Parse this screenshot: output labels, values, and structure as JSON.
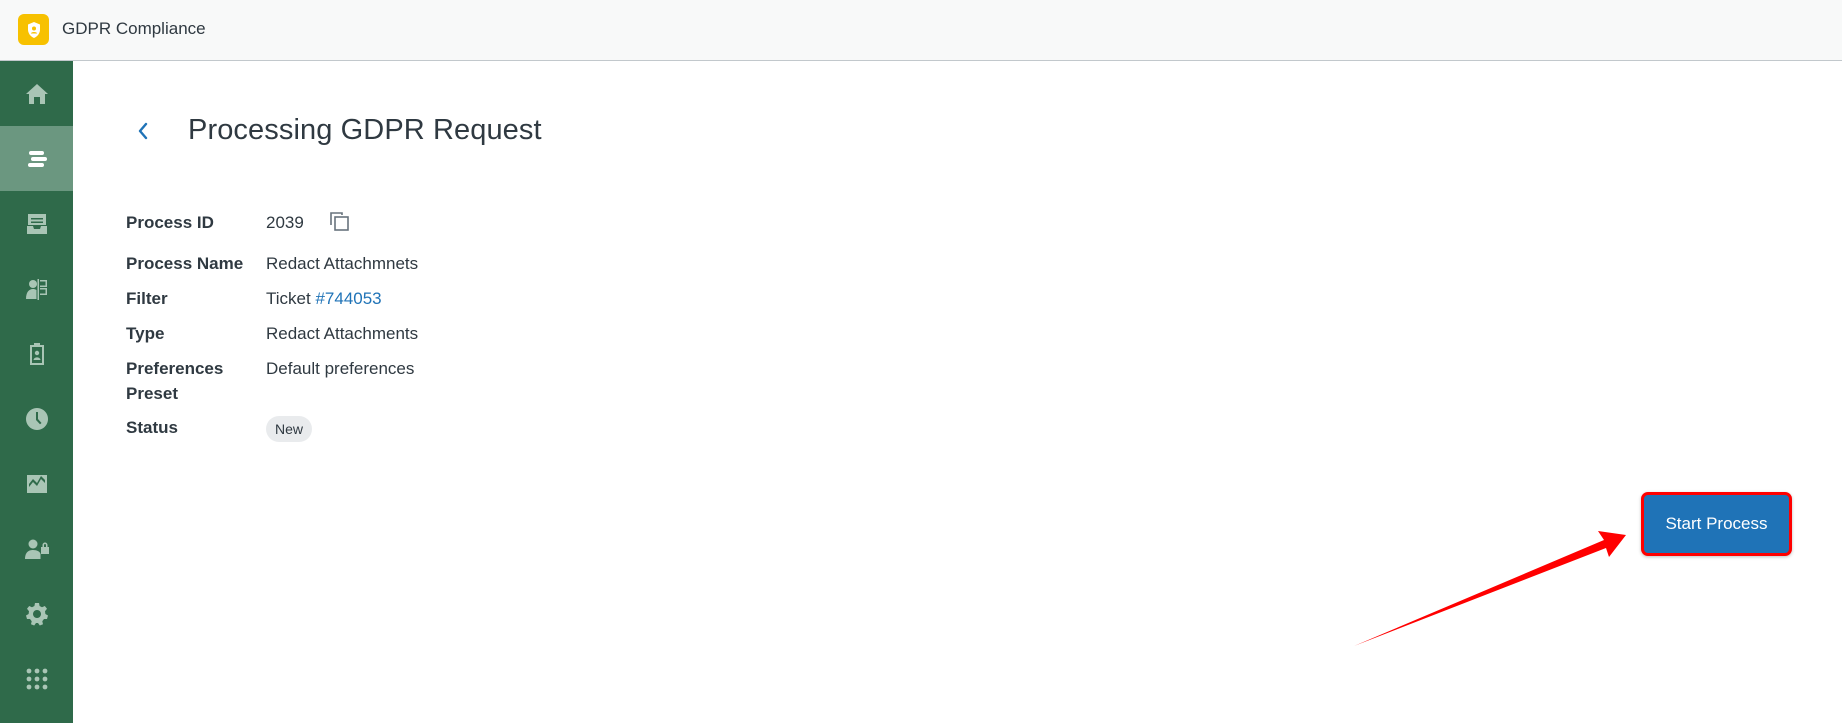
{
  "app": {
    "title": "GDPR Compliance",
    "logo_icon": "shield-user-icon",
    "logo_color": "#f7c100"
  },
  "sidebar": {
    "background": "#2f6a4a",
    "active_index": 1,
    "items": [
      {
        "name": "home",
        "icon": "home-icon"
      },
      {
        "name": "requests",
        "icon": "list-icon"
      },
      {
        "name": "archive",
        "icon": "archive-icon"
      },
      {
        "name": "contacts",
        "icon": "person-book-icon"
      },
      {
        "name": "reports",
        "icon": "clipboard-user-icon"
      },
      {
        "name": "history",
        "icon": "clock-icon"
      },
      {
        "name": "analytics",
        "icon": "chart-icon"
      },
      {
        "name": "access",
        "icon": "user-lock-icon"
      },
      {
        "name": "settings",
        "icon": "gear-icon"
      },
      {
        "name": "apps",
        "icon": "grid-icon"
      }
    ]
  },
  "page": {
    "title": "Processing GDPR Request",
    "back_icon": "chevron-left-icon"
  },
  "details": {
    "process_id": {
      "label": "Process ID",
      "value": "2039"
    },
    "process_name": {
      "label": "Process Name",
      "value": "Redact Attachmnets"
    },
    "filter": {
      "label": "Filter",
      "prefix": "Ticket",
      "link": "#744053"
    },
    "type": {
      "label": "Type",
      "value": "Redact Attachments"
    },
    "preferences_preset": {
      "label_line1": "Preferences",
      "label_line2": "Preset",
      "link": "Default preferences"
    },
    "status": {
      "label": "Status",
      "value": "New"
    }
  },
  "actions": {
    "start_process": "Start Process",
    "accent": "#1f73b7"
  },
  "annotation": {
    "type": "red-arrow",
    "color": "#ff0000",
    "target": "start-process-button"
  }
}
